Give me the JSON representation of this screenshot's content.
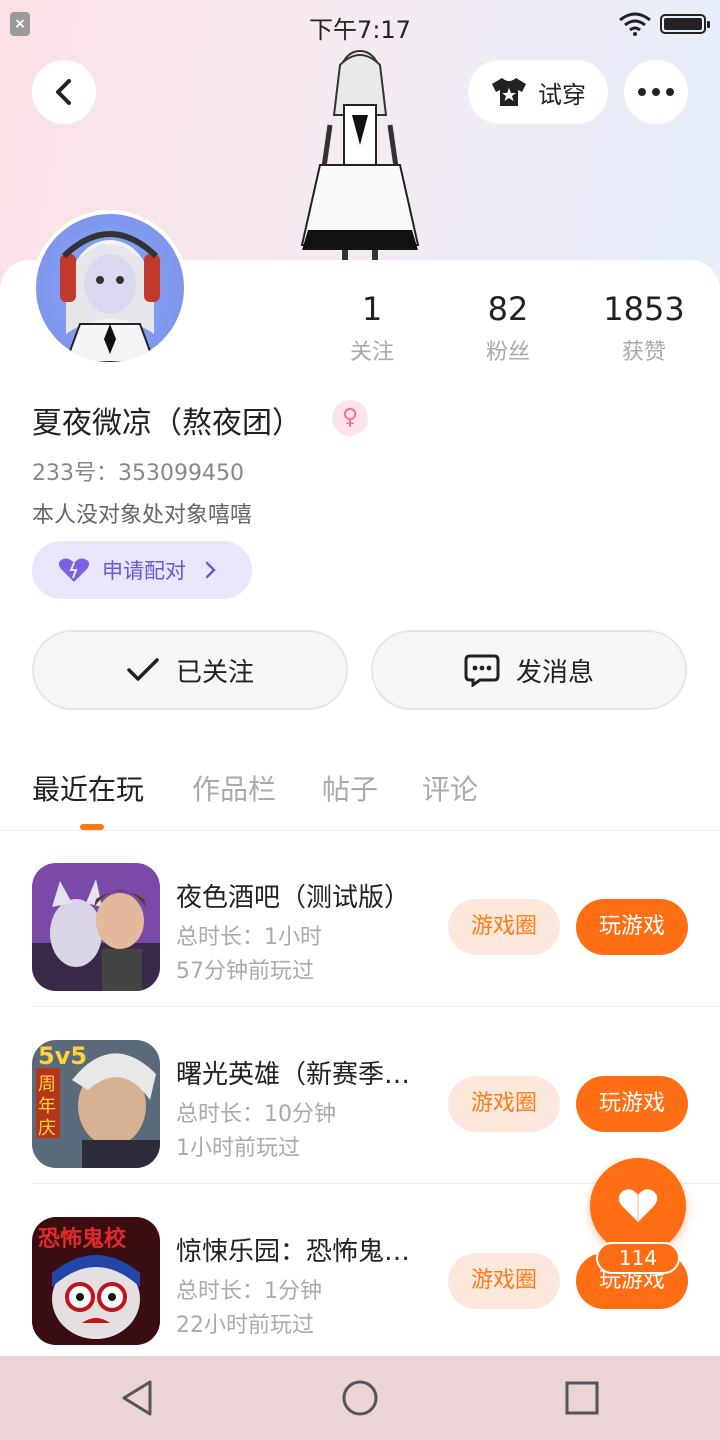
{
  "status_bar": {
    "time": "下午7:17"
  },
  "header": {
    "tryon_label": "试穿"
  },
  "profile": {
    "stats": [
      {
        "value": "1",
        "label": "关注"
      },
      {
        "value": "82",
        "label": "粉丝"
      },
      {
        "value": "1853",
        "label": "获赞"
      }
    ],
    "username": "夏夜微凉（熬夜团）",
    "gender_symbol": "♀",
    "user_id": "233号：353099450",
    "bio": "本人没对象处对象嘻嘻",
    "match_label": "申请配对"
  },
  "actions": {
    "follow_label": "已关注",
    "message_label": "发消息"
  },
  "tabs": [
    {
      "label": "最近在玩",
      "active": true
    },
    {
      "label": "作品栏",
      "active": false
    },
    {
      "label": "帖子",
      "active": false
    },
    {
      "label": "评论",
      "active": false
    }
  ],
  "games": [
    {
      "name": "夜色酒吧（测试版）",
      "duration": "总时长：1小时",
      "last_played": "57分钟前玩过",
      "circle_label": "游戏圈",
      "play_label": "玩游戏"
    },
    {
      "name": "曙光英雄（新赛季…",
      "duration": "总时长：10分钟",
      "last_played": "1小时前玩过",
      "circle_label": "游戏圈",
      "play_label": "玩游戏",
      "icon_text": "5v5",
      "icon_badge": "周年庆"
    },
    {
      "name": "惊悚乐园：恐怖鬼…",
      "duration": "总时长：1分钟",
      "last_played": "22小时前玩过",
      "circle_label": "游戏圈",
      "play_label": "玩游戏",
      "icon_text": "恐怖鬼校"
    }
  ],
  "like": {
    "count": "114"
  },
  "colors": {
    "accent": "#ff6e14",
    "purple": "#6c58d4"
  }
}
